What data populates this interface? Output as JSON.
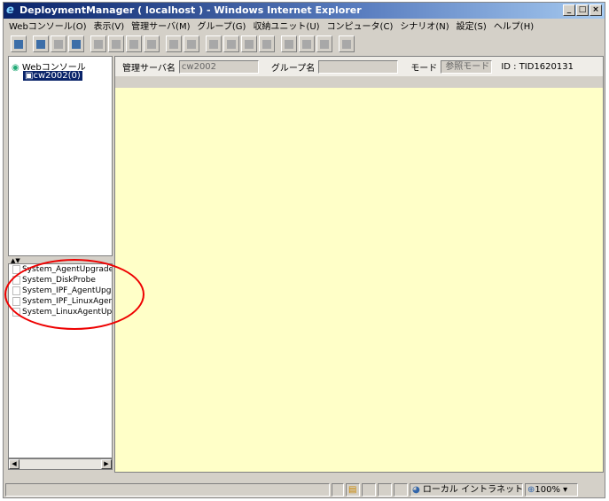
{
  "window": {
    "title": "DeploymentManager ( localhost ) - Windows Internet Explorer",
    "controls": [
      "_",
      "□",
      "×"
    ]
  },
  "menu": [
    "Webコンソール(O)",
    "表示(V)",
    "管理サーバ(M)",
    "グループ(G)",
    "収納ユニット(U)",
    "コンピュータ(C)",
    "シナリオ(N)",
    "設定(S)",
    "ヘルプ(H)"
  ],
  "tree": {
    "root": "Webコンソール",
    "child": "cw2002(0)"
  },
  "splitter": "▲▼",
  "scenarios": [
    "System_AgentUpgrade_M",
    "System_DiskProbe",
    "System_IPF_AgentUpgrad",
    "System_IPF_LinuxAgentU",
    "System_LinuxAgentUpgr"
  ],
  "header": {
    "server_label": "管理サーバ名",
    "server_value": "cw2002",
    "group_label": "グループ名",
    "group_value": "",
    "mode_label": "モード",
    "mode_value": "参照モード",
    "id": "ID : TID1620131"
  },
  "statusbar": {
    "zone": "ローカル イントラネット",
    "zoom": "100%",
    "zoom_arrow": "▾"
  },
  "colors": {
    "content_bg": "#ffffc8",
    "annotation": "#e00000",
    "selection": "#0a246a"
  }
}
